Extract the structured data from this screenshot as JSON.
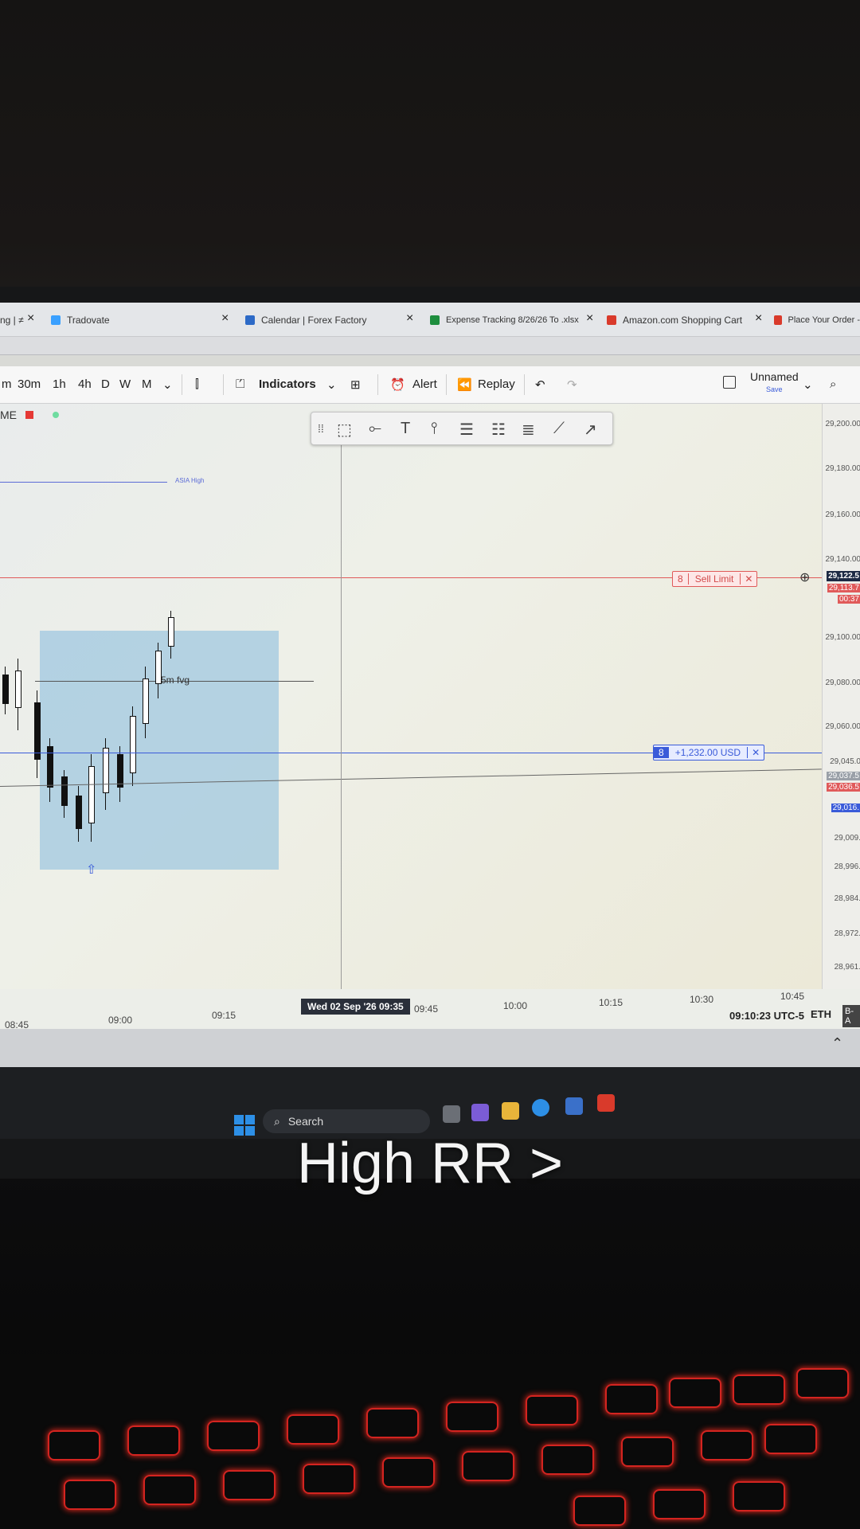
{
  "browser": {
    "tabs": [
      {
        "label": "ng | ≠",
        "icon": "generic-tab-icon"
      },
      {
        "label": "Tradovate",
        "icon": "tradovate-icon"
      },
      {
        "label": "Calendar | Forex Factory",
        "icon": "calendar-icon"
      },
      {
        "label": "Expense Tracking 8/26/26 To .xlsx",
        "icon": "spreadsheet-icon"
      },
      {
        "label": "Amazon.com Shopping Cart",
        "icon": "amazon-icon"
      },
      {
        "label": "Place Your Order -",
        "icon": "amazon-icon"
      }
    ]
  },
  "toolbar": {
    "intervals": [
      "m",
      "30m",
      "1h",
      "4h",
      "D",
      "W",
      "M"
    ],
    "indicators_label": "Indicators",
    "alert_label": "Alert",
    "replay_label": "Replay",
    "layout_label": "Unnamed",
    "layout_sub": "Save"
  },
  "chart": {
    "symbol_partial": "ME",
    "price_labels": [
      "29,200.00",
      "29,180.00",
      "29,160.00",
      "29,140.00",
      "29,122.5",
      "29,113.7",
      "00:37",
      "29,100.00",
      "29,080.00",
      "29,060.00",
      "29,045.0",
      "29,037.5",
      "29,036.5",
      "29,016.",
      "29,009.",
      "28,996.",
      "28,984.",
      "28,972.",
      "28,961."
    ],
    "asia_high_label": "ASIA High",
    "fvg_label": "5m fvg",
    "sell_order": {
      "qty": "8",
      "label": "Sell Limit",
      "close": "✕"
    },
    "pnl_order": {
      "qty": "8",
      "label": "+1,232.00 USD",
      "close": "✕"
    },
    "time_labels": [
      "08:45",
      "09:00",
      "09:15",
      "09:45",
      "10:00",
      "10:15",
      "10:30",
      "10:45"
    ],
    "crosshair_time": "Wed 02 Sep '26  09:35",
    "clock": "09:10:23 UTC-5",
    "session": "ETH",
    "ba_label": "B-A"
  },
  "taskbar": {
    "search_placeholder": "Search"
  },
  "overlay": {
    "caption": "High RR >"
  },
  "colors": {
    "sell_line": "#e05a5a",
    "position_line": "#3a5bd9",
    "fvg_box": "#85b9dc",
    "keyboard_glow": "#ff2b1f"
  }
}
